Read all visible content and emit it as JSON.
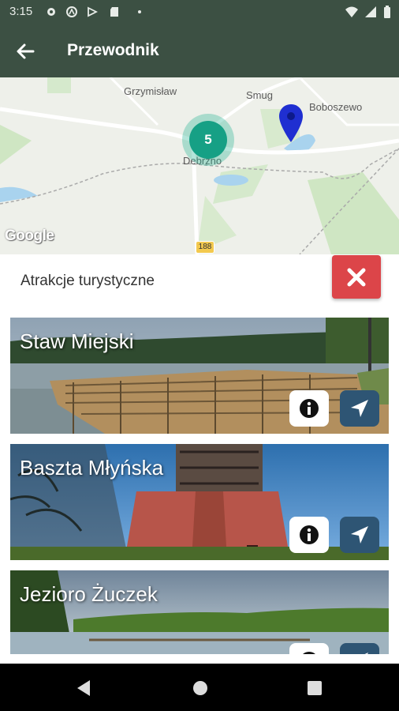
{
  "status_bar": {
    "time": "3:15"
  },
  "app_bar": {
    "title": "Przewodnik"
  },
  "map": {
    "labels": [
      "Grzymisław",
      "Smug",
      "Boboszewo",
      "Debrzno"
    ],
    "cluster_count": "5",
    "road_number": "188",
    "attribution": "Google"
  },
  "list": {
    "heading": "Atrakcje turystyczne",
    "items": [
      {
        "title": "Staw Miejski"
      },
      {
        "title": "Baszta Młyńska"
      },
      {
        "title": "Jezioro Żuczek"
      }
    ]
  },
  "colors": {
    "app_bar": "#3c5043",
    "cluster": "#16a085",
    "close_button": "#dc4549",
    "nav_button": "#2e5574",
    "marker": "#1f2fd1"
  }
}
